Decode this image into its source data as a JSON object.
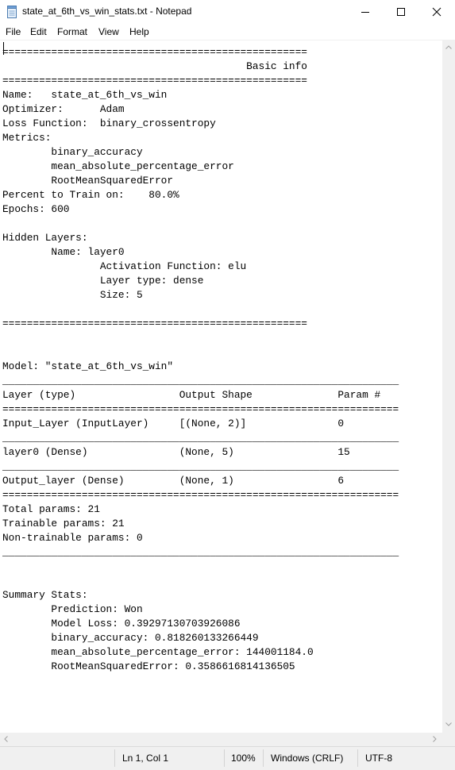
{
  "window": {
    "title": "state_at_6th_vs_win_stats.txt - Notepad",
    "icons": {
      "app": "notepad-icon",
      "minimize": "minimize-icon",
      "maximize": "maximize-icon",
      "close": "close-icon"
    }
  },
  "menu": {
    "items": [
      "File",
      "Edit",
      "Format",
      "View",
      "Help"
    ]
  },
  "editor": {
    "content": "==================================================\n                                        Basic info\n==================================================\nName:   state_at_6th_vs_win\nOptimizer:      Adam\nLoss Function:  binary_crossentropy\nMetrics:\n        binary_accuracy\n        mean_absolute_percentage_error\n        RootMeanSquaredError\nPercent to Train on:    80.0%\nEpochs: 600\n\nHidden Layers:\n        Name: layer0\n                Activation Function: elu\n                Layer type: dense\n                Size: 5\n\n==================================================\n\n\nModel: \"state_at_6th_vs_win\"\n_________________________________________________________________\nLayer (type)                 Output Shape              Param #   \n=================================================================\nInput_Layer (InputLayer)     [(None, 2)]               0         \n_________________________________________________________________\nlayer0 (Dense)               (None, 5)                 15        \n_________________________________________________________________\nOutput_layer (Dense)         (None, 1)                 6         \n=================================================================\nTotal params: 21\nTrainable params: 21\nNon-trainable params: 0\n_________________________________________________________________\n\n\nSummary Stats:\n        Prediction: Won\n        Model Loss: 0.39297130703926086\n        binary_accuracy: 0.818260133266449\n        mean_absolute_percentage_error: 144001184.0\n        RootMeanSquaredError: 0.3586616814136505"
  },
  "status": {
    "position": "Ln 1, Col 1",
    "zoom": "100%",
    "line_ending": "Windows (CRLF)",
    "encoding": "UTF-8"
  }
}
